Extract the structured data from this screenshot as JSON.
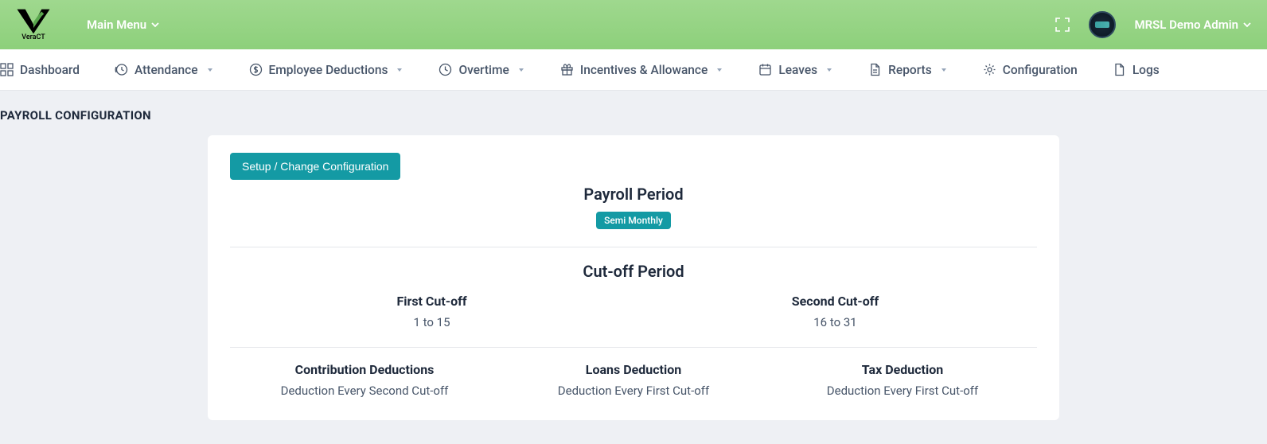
{
  "header": {
    "logo_text": "VeraCT",
    "main_menu_label": "Main Menu",
    "user_name": "MRSL Demo Admin"
  },
  "nav": {
    "items": [
      {
        "label": "Dashboard",
        "has_dropdown": false
      },
      {
        "label": "Attendance",
        "has_dropdown": true
      },
      {
        "label": "Employee Deductions",
        "has_dropdown": true
      },
      {
        "label": "Overtime",
        "has_dropdown": true
      },
      {
        "label": "Incentives & Allowance",
        "has_dropdown": true
      },
      {
        "label": "Leaves",
        "has_dropdown": true
      },
      {
        "label": "Reports",
        "has_dropdown": true
      },
      {
        "label": "Configuration",
        "has_dropdown": false
      },
      {
        "label": "Logs",
        "has_dropdown": false
      }
    ]
  },
  "page": {
    "title": "PAYROLL CONFIGURATION"
  },
  "card": {
    "setup_button": "Setup / Change Configuration",
    "payroll_period_title": "Payroll Period",
    "payroll_period_badge": "Semi Monthly",
    "cutoff_title": "Cut-off Period",
    "cutoffs": [
      {
        "label": "First Cut-off",
        "value": "1 to 15"
      },
      {
        "label": "Second Cut-off",
        "value": "16 to 31"
      }
    ],
    "deductions": [
      {
        "label": "Contribution Deductions",
        "value": "Deduction Every Second Cut-off"
      },
      {
        "label": "Loans Deduction",
        "value": "Deduction Every First Cut-off"
      },
      {
        "label": "Tax Deduction",
        "value": "Deduction Every First Cut-off"
      }
    ]
  }
}
